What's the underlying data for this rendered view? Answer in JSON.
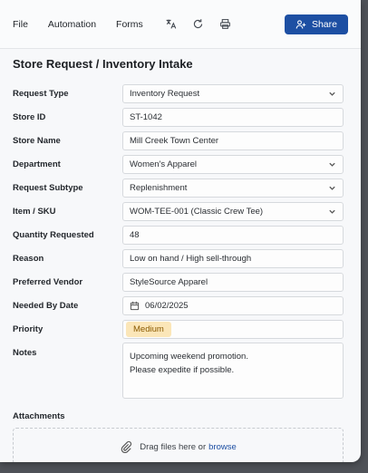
{
  "toolbar": {
    "menu": [
      "File",
      "Automation",
      "Forms"
    ],
    "icons": [
      "translate-icon",
      "refresh-icon",
      "print-icon"
    ],
    "share_label": "Share"
  },
  "form": {
    "title": "Store Request / Inventory Intake",
    "fields": {
      "request_type": {
        "label": "Request Type",
        "value": "Inventory Request"
      },
      "store_id": {
        "label": "Store ID",
        "value": "ST-1042"
      },
      "store_name": {
        "label": "Store Name",
        "value": "Mill Creek Town Center"
      },
      "department": {
        "label": "Department",
        "value": "Women's Apparel"
      },
      "request_subtype": {
        "label": "Request Subtype",
        "value": "Replenishment"
      },
      "item_sku": {
        "label": "Item / SKU",
        "value": "WOM-TEE-001 (Classic Crew Tee)"
      },
      "quantity": {
        "label": "Quantity Requested",
        "value": "48"
      },
      "reason": {
        "label": "Reason",
        "value": "Low on hand / High sell-through"
      },
      "vendor": {
        "label": "Preferred Vendor",
        "value": "StyleSource Apparel"
      },
      "needed_by": {
        "label": "Needed By Date",
        "value": "06/02/2025"
      },
      "priority": {
        "label": "Priority",
        "value": "Medium"
      },
      "notes": {
        "label": "Notes",
        "line1": "Upcoming weekend promotion.",
        "line2": "Please expedite if possible."
      }
    },
    "attachments": {
      "label": "Attachments",
      "drop_text": "Drag files here or",
      "browse_text": "browse"
    }
  },
  "colors": {
    "accent": "#1d4fa3",
    "priority_bg": "#fbe6b8",
    "priority_text": "#8a5a00"
  }
}
